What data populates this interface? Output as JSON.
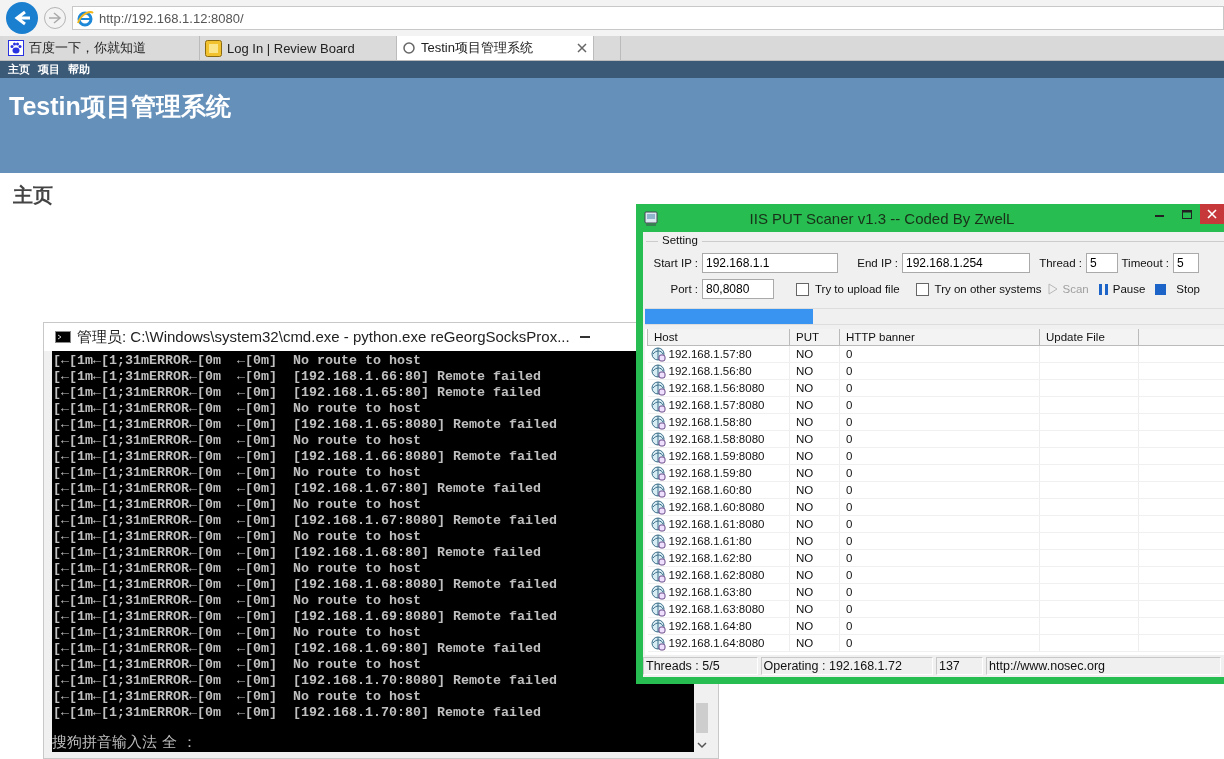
{
  "browser": {
    "address": "http://192.168.1.12:8080/",
    "tabs": [
      {
        "label": "百度一下，你就知道",
        "kind": "baidu",
        "selected": false
      },
      {
        "label": "Log In | Review Board",
        "kind": "board",
        "selected": false
      },
      {
        "label": "Testin项目管理系统",
        "kind": "loading",
        "selected": true
      }
    ],
    "menu": [
      "主页",
      "项目",
      "帮助"
    ],
    "site_title": "Testin项目管理系统",
    "heading": "主页"
  },
  "cmd_window": {
    "title": "管理员: C:\\Windows\\system32\\cmd.exe - python.exe  reGeorgSocksProx...",
    "lines": [
      "[←[1m←[1;31mERROR←[0m  ←[0m]  No route to host",
      "[←[1m←[1;31mERROR←[0m  ←[0m]  [192.168.1.66:80] Remote failed",
      "[←[1m←[1;31mERROR←[0m  ←[0m]  [192.168.1.65:80] Remote failed",
      "[←[1m←[1;31mERROR←[0m  ←[0m]  No route to host",
      "[←[1m←[1;31mERROR←[0m  ←[0m]  [192.168.1.65:8080] Remote failed",
      "[←[1m←[1;31mERROR←[0m  ←[0m]  No route to host",
      "[←[1m←[1;31mERROR←[0m  ←[0m]  [192.168.1.66:8080] Remote failed",
      "[←[1m←[1;31mERROR←[0m  ←[0m]  No route to host",
      "[←[1m←[1;31mERROR←[0m  ←[0m]  [192.168.1.67:80] Remote failed",
      "[←[1m←[1;31mERROR←[0m  ←[0m]  No route to host",
      "[←[1m←[1;31mERROR←[0m  ←[0m]  [192.168.1.67:8080] Remote failed",
      "[←[1m←[1;31mERROR←[0m  ←[0m]  No route to host",
      "[←[1m←[1;31mERROR←[0m  ←[0m]  [192.168.1.68:80] Remote failed",
      "[←[1m←[1;31mERROR←[0m  ←[0m]  No route to host",
      "[←[1m←[1;31mERROR←[0m  ←[0m]  [192.168.1.68:8080] Remote failed",
      "[←[1m←[1;31mERROR←[0m  ←[0m]  No route to host",
      "[←[1m←[1;31mERROR←[0m  ←[0m]  [192.168.1.69:8080] Remote failed",
      "[←[1m←[1;31mERROR←[0m  ←[0m]  No route to host",
      "[←[1m←[1;31mERROR←[0m  ←[0m]  [192.168.1.69:80] Remote failed",
      "[←[1m←[1;31mERROR←[0m  ←[0m]  No route to host",
      "[←[1m←[1;31mERROR←[0m  ←[0m]  [192.168.1.70:8080] Remote failed",
      "[←[1m←[1;31mERROR←[0m  ←[0m]  No route to host",
      "[←[1m←[1;31mERROR←[0m  ←[0m]  [192.168.1.70:80] Remote failed"
    ],
    "ime_text": "搜狗拼音输入法 全 ："
  },
  "scanner_window": {
    "title": "IIS PUT Scaner v1.3 -- Coded By ZwelL",
    "group_label": "Setting",
    "start_ip": {
      "label": "Start IP :",
      "value": "192.168.1.1"
    },
    "end_ip": {
      "label": "End IP :",
      "value": "192.168.1.254"
    },
    "thread": {
      "label": "Thread :",
      "value": "5"
    },
    "timeout": {
      "label": "Timeout :",
      "value": "5"
    },
    "port": {
      "label": "Port :",
      "value": "80,8080"
    },
    "checkboxes": [
      {
        "label": "Try to upload file",
        "checked": false
      },
      {
        "label": "Try on other systems",
        "checked": false
      }
    ],
    "buttons": [
      {
        "label": "Scan",
        "kind": "scan",
        "disabled": true
      },
      {
        "label": "Pause",
        "kind": "pause",
        "disabled": false
      },
      {
        "label": "Stop",
        "kind": "stop",
        "disabled": false
      }
    ],
    "progress": {
      "level": 0.29
    },
    "table": {
      "columns": [
        "Host",
        "PUT",
        "HTTP banner",
        "Update File"
      ],
      "rows": [
        [
          "192.168.1.57:80",
          "NO",
          "0"
        ],
        [
          "192.168.1.56:80",
          "NO",
          "0"
        ],
        [
          "192.168.1.56:8080",
          "NO",
          "0"
        ],
        [
          "192.168.1.57:8080",
          "NO",
          "0"
        ],
        [
          "192.168.1.58:80",
          "NO",
          "0"
        ],
        [
          "192.168.1.58:8080",
          "NO",
          "0"
        ],
        [
          "192.168.1.59:8080",
          "NO",
          "0"
        ],
        [
          "192.168.1.59:80",
          "NO",
          "0"
        ],
        [
          "192.168.1.60:80",
          "NO",
          "0"
        ],
        [
          "192.168.1.60:8080",
          "NO",
          "0"
        ],
        [
          "192.168.1.61:8080",
          "NO",
          "0"
        ],
        [
          "192.168.1.61:80",
          "NO",
          "0"
        ],
        [
          "192.168.1.62:80",
          "NO",
          "0"
        ],
        [
          "192.168.1.62:8080",
          "NO",
          "0"
        ],
        [
          "192.168.1.63:80",
          "NO",
          "0"
        ],
        [
          "192.168.1.63:8080",
          "NO",
          "0"
        ],
        [
          "192.168.1.64:80",
          "NO",
          "0"
        ],
        [
          "192.168.1.64:8080",
          "NO",
          "0"
        ]
      ]
    },
    "status_bar": [
      "Threads : 5/5",
      "Operating : 192.168.1.72",
      "137",
      "http://www.nosec.org"
    ]
  }
}
